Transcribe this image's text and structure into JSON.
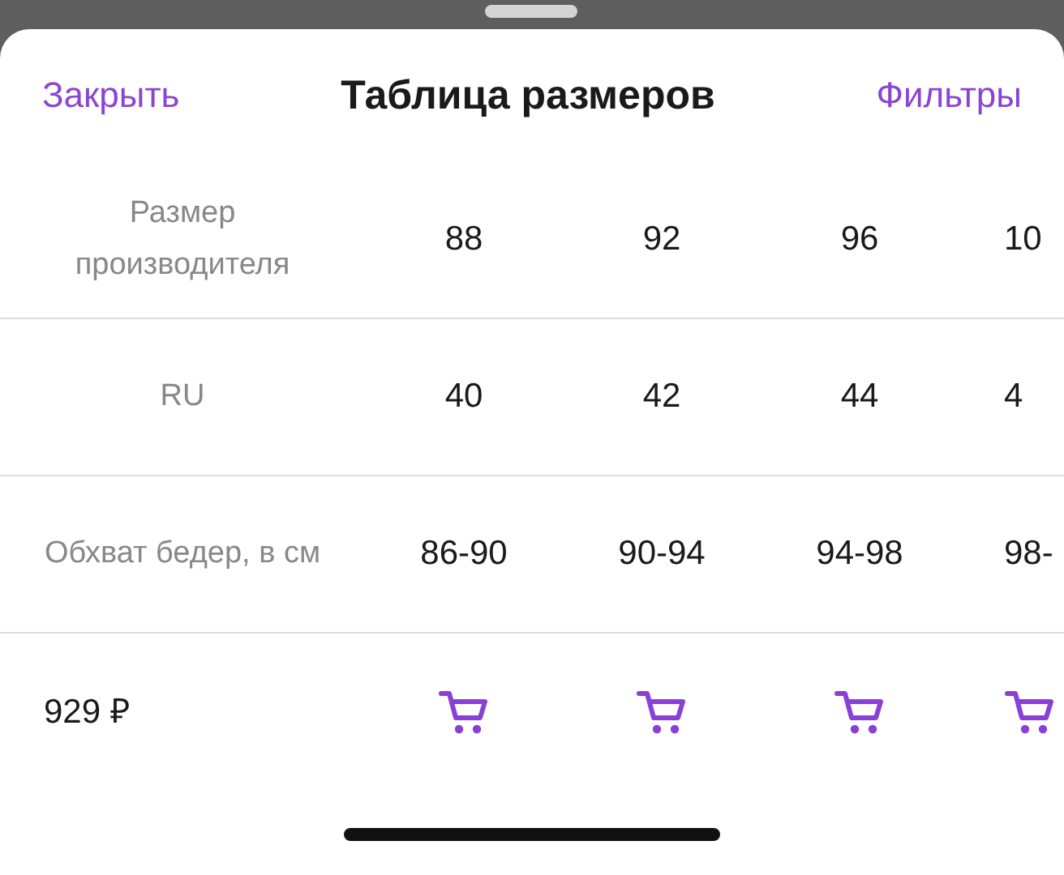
{
  "header": {
    "close": "Закрыть",
    "title": "Таблица размеров",
    "filters": "Фильтры"
  },
  "rows": [
    {
      "label": "Размер производителя",
      "values": [
        "88",
        "92",
        "96",
        "10"
      ]
    },
    {
      "label": "RU",
      "values": [
        "40",
        "42",
        "44",
        "4"
      ]
    },
    {
      "label": "Обхват бедер, в см",
      "values": [
        "86-90",
        "90-94",
        "94-98",
        "98-"
      ]
    }
  ],
  "offer": {
    "price": "929 ₽",
    "actions": [
      {
        "kind": "cart"
      },
      {
        "kind": "cart"
      },
      {
        "kind": "cart"
      },
      {
        "kind": "cart"
      }
    ]
  }
}
